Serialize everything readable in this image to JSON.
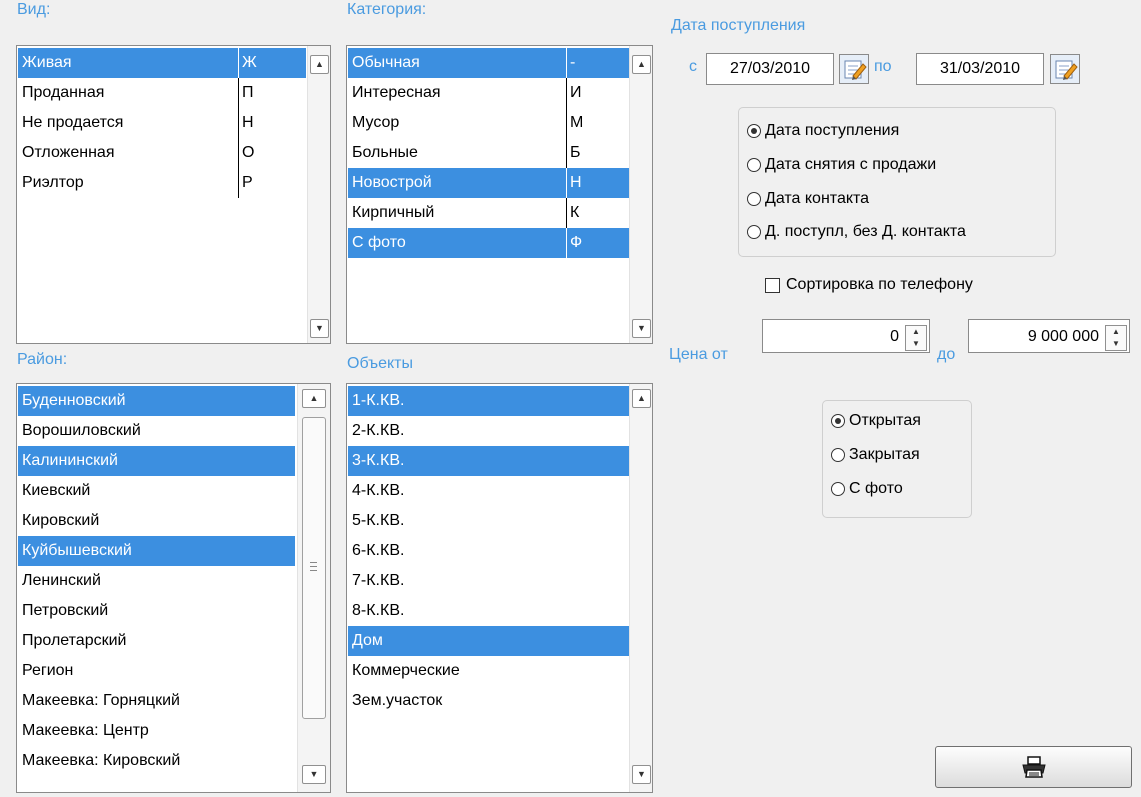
{
  "vid": {
    "label": "Вид:",
    "items": [
      {
        "text": "Живая",
        "code": "Ж",
        "selected": true
      },
      {
        "text": "Проданная",
        "code": "П",
        "selected": false
      },
      {
        "text": "Не продается",
        "code": "Н",
        "selected": false
      },
      {
        "text": "Отложенная",
        "code": "О",
        "selected": false
      },
      {
        "text": "Риэлтор",
        "code": "Р",
        "selected": false
      }
    ]
  },
  "kategoriya": {
    "label": "Категория:",
    "items": [
      {
        "text": "Обычная",
        "code": "-",
        "selected": true
      },
      {
        "text": "Интересная",
        "code": "И",
        "selected": false
      },
      {
        "text": "Мусор",
        "code": "М",
        "selected": false
      },
      {
        "text": "Больные",
        "code": "Б",
        "selected": false
      },
      {
        "text": "Новострой",
        "code": "Н",
        "selected": true
      },
      {
        "text": "Кирпичный",
        "code": "К",
        "selected": false
      },
      {
        "text": "С фото",
        "code": "Ф",
        "selected": true
      }
    ]
  },
  "raion": {
    "label": "Район:",
    "items": [
      {
        "text": "Буденновский",
        "selected": true
      },
      {
        "text": "Ворошиловский",
        "selected": false
      },
      {
        "text": "Калининский",
        "selected": true
      },
      {
        "text": "Киевский",
        "selected": false
      },
      {
        "text": "Кировский",
        "selected": false
      },
      {
        "text": "Куйбышевский",
        "selected": true
      },
      {
        "text": "Ленинский",
        "selected": false
      },
      {
        "text": "Петровский",
        "selected": false
      },
      {
        "text": "Пролетарский",
        "selected": false
      },
      {
        "text": "Регион",
        "selected": false
      },
      {
        "text": "Макеевка: Горняцкий",
        "selected": false
      },
      {
        "text": "Макеевка: Центр",
        "selected": false
      },
      {
        "text": "Макеевка: Кировский",
        "selected": false
      }
    ]
  },
  "obekty": {
    "label": "Объекты",
    "items": [
      {
        "text": "1-К.КВ.",
        "selected": true
      },
      {
        "text": "2-К.КВ.",
        "selected": false
      },
      {
        "text": "3-К.КВ.",
        "selected": true
      },
      {
        "text": "4-К.КВ.",
        "selected": false
      },
      {
        "text": "5-К.КВ.",
        "selected": false
      },
      {
        "text": "6-К.КВ.",
        "selected": false
      },
      {
        "text": "7-К.КВ.",
        "selected": false
      },
      {
        "text": "8-К.КВ.",
        "selected": false
      },
      {
        "text": "Дом",
        "selected": true
      },
      {
        "text": "Коммерческие",
        "selected": false
      },
      {
        "text": "Зем.участок",
        "selected": false
      }
    ]
  },
  "date": {
    "title": "Дата поступления",
    "from_label": "с",
    "from_value": "27/03/2010",
    "to_label": "по",
    "to_value": "31/03/2010"
  },
  "date_type": {
    "options": [
      {
        "label": "Дата поступления",
        "checked": true
      },
      {
        "label": "Дата снятия с продажи",
        "checked": false
      },
      {
        "label": "Дата контакта",
        "checked": false
      },
      {
        "label": "Д. поступл, без Д. контакта",
        "checked": false
      }
    ]
  },
  "sort_phone": {
    "label": "Сортировка по телефону",
    "checked": false
  },
  "price": {
    "from_label": "Цена от",
    "from_value": "0",
    "to_label": "до",
    "to_value": "9 000 000"
  },
  "visibility": {
    "options": [
      {
        "label": "Открытая",
        "checked": true
      },
      {
        "label": "Закрытая",
        "checked": false
      },
      {
        "label": "С фото",
        "checked": false
      }
    ]
  },
  "icons": {
    "scroll_up": "▲",
    "scroll_down": "▼",
    "calendar": "calendar-edit-icon",
    "print": "printer-icon"
  },
  "colors": {
    "selection": "#3c8fe0",
    "label": "#4a9be0"
  }
}
